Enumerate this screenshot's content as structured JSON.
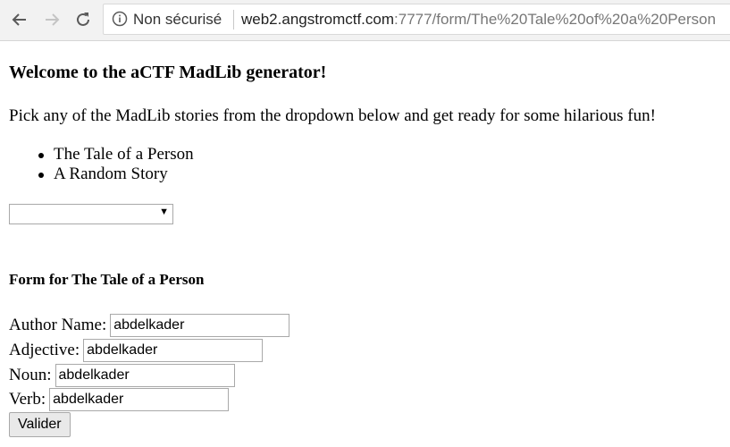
{
  "browser": {
    "security_label": "Non sécurisé",
    "url_host": "web2.angstromctf.com",
    "url_rest": ":7777/form/The%20Tale%20of%20a%20Person"
  },
  "page": {
    "title": "Welcome to the aCTF MadLib generator!",
    "intro": "Pick any of the MadLib stories from the dropdown below and get ready for some hilarious fun!",
    "stories": [
      "The Tale of a Person",
      "A Random Story"
    ],
    "story_select_value": ""
  },
  "form": {
    "title": "Form for The Tale of a Person",
    "fields": [
      {
        "label": "Author Name:",
        "value": "abdelkader"
      },
      {
        "label": "Adjective:",
        "value": "abdelkader"
      },
      {
        "label": "Noun:",
        "value": "abdelkader"
      },
      {
        "label": "Verb:",
        "value": "abdelkader"
      }
    ],
    "submit_label": "Valider"
  }
}
